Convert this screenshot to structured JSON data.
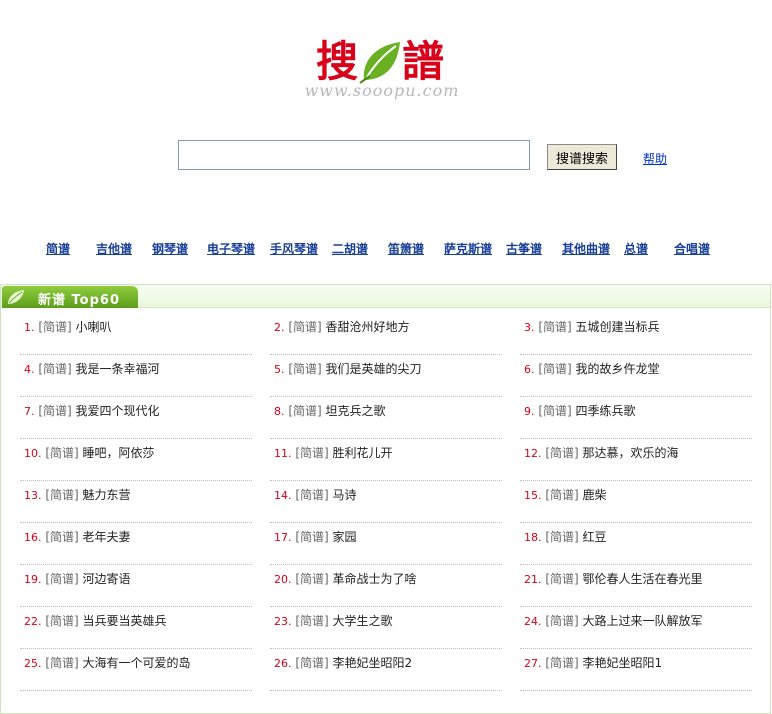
{
  "logo": {
    "text_left": "搜",
    "text_right": "譜",
    "url": "www.sooopu.com",
    "colors": {
      "text": "#d9001a",
      "leaf": "#6ab023",
      "url": "#b8b8b8"
    }
  },
  "search": {
    "input_value": "",
    "button_label": "搜谱搜索",
    "help_label": "帮助"
  },
  "categories": [
    {
      "label": "简谱"
    },
    {
      "label": "吉他谱"
    },
    {
      "label": "钢琴谱"
    },
    {
      "label": "电子琴谱"
    },
    {
      "label": "手风琴谱"
    },
    {
      "label": "二胡谱"
    },
    {
      "label": "笛箫谱"
    },
    {
      "label": "萨克斯谱"
    },
    {
      "label": "古筝谱"
    },
    {
      "label": "其他曲谱"
    },
    {
      "label": "总谱"
    },
    {
      "label": "合唱谱"
    }
  ],
  "panel": {
    "title": "新谱  Top60",
    "items": [
      {
        "num": "1.",
        "tag": "[简谱]",
        "title": "小喇叭"
      },
      {
        "num": "2.",
        "tag": "[简谱]",
        "title": "香甜沧州好地方"
      },
      {
        "num": "3.",
        "tag": "[简谱]",
        "title": "五城创建当标兵"
      },
      {
        "num": "4.",
        "tag": "[简谱]",
        "title": "我是一条幸福河"
      },
      {
        "num": "5.",
        "tag": "[简谱]",
        "title": "我们是英雄的尖刀"
      },
      {
        "num": "6.",
        "tag": "[简谱]",
        "title": "我的故乡仵龙堂"
      },
      {
        "num": "7.",
        "tag": "[简谱]",
        "title": "我爱四个现代化"
      },
      {
        "num": "8.",
        "tag": "[简谱]",
        "title": "坦克兵之歌"
      },
      {
        "num": "9.",
        "tag": "[简谱]",
        "title": "四季练兵歌"
      },
      {
        "num": "10.",
        "tag": "[简谱]",
        "title": "睡吧，阿依莎"
      },
      {
        "num": "11.",
        "tag": "[简谱]",
        "title": "胜利花儿开"
      },
      {
        "num": "12.",
        "tag": "[简谱]",
        "title": "那达慕，欢乐的海"
      },
      {
        "num": "13.",
        "tag": "[简谱]",
        "title": "魅力东营"
      },
      {
        "num": "14.",
        "tag": "[简谱]",
        "title": "马诗"
      },
      {
        "num": "15.",
        "tag": "[简谱]",
        "title": "鹿柴"
      },
      {
        "num": "16.",
        "tag": "[简谱]",
        "title": "老年夫妻"
      },
      {
        "num": "17.",
        "tag": "[简谱]",
        "title": "家园"
      },
      {
        "num": "18.",
        "tag": "[简谱]",
        "title": "红豆"
      },
      {
        "num": "19.",
        "tag": "[简谱]",
        "title": "河边寄语"
      },
      {
        "num": "20.",
        "tag": "[简谱]",
        "title": "革命战士为了啥"
      },
      {
        "num": "21.",
        "tag": "[简谱]",
        "title": "鄂伦春人生活在春光里"
      },
      {
        "num": "22.",
        "tag": "[简谱]",
        "title": "当兵要当英雄兵"
      },
      {
        "num": "23.",
        "tag": "[简谱]",
        "title": "大学生之歌"
      },
      {
        "num": "24.",
        "tag": "[简谱]",
        "title": "大路上过来一队解放军"
      },
      {
        "num": "25.",
        "tag": "[简谱]",
        "title": "大海有一个可爱的岛"
      },
      {
        "num": "26.",
        "tag": "[简谱]",
        "title": "李艳妃坐昭阳2"
      },
      {
        "num": "27.",
        "tag": "[简谱]",
        "title": "李艳妃坐昭阳1"
      }
    ]
  },
  "colors": {
    "category_link": "#1a3f96",
    "item_number": "#d9001a",
    "panel_tab": "#6aa82a",
    "panel_border": "#cfe3c0"
  }
}
